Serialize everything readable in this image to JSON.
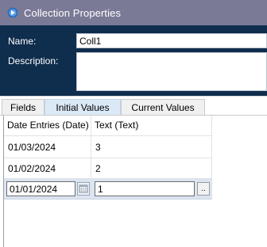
{
  "window": {
    "title": "Collection Properties"
  },
  "form": {
    "name_label": "Name:",
    "name_value": "Coll1",
    "description_label": "Description:",
    "description_value": ""
  },
  "tabs": [
    {
      "label": "Fields",
      "active": false
    },
    {
      "label": "Initial Values",
      "active": true
    },
    {
      "label": "Current Values",
      "active": false
    }
  ],
  "grid": {
    "columns": [
      "Date Entries  (Date)",
      "Text  (Text)"
    ],
    "rows": [
      [
        "01/03/2024",
        "3"
      ],
      [
        "01/02/2024",
        "2"
      ]
    ],
    "edit_row": {
      "date": "01/01/2024",
      "text": "1",
      "ellipsis": ".."
    }
  },
  "colors": {
    "titlebar": "#7a7a97",
    "header_panel": "#0f2d4c",
    "active_tab": "#dbe9f7",
    "edit_row": "#dbe5f1"
  },
  "icons": [
    "app-icon",
    "calendar-icon"
  ]
}
